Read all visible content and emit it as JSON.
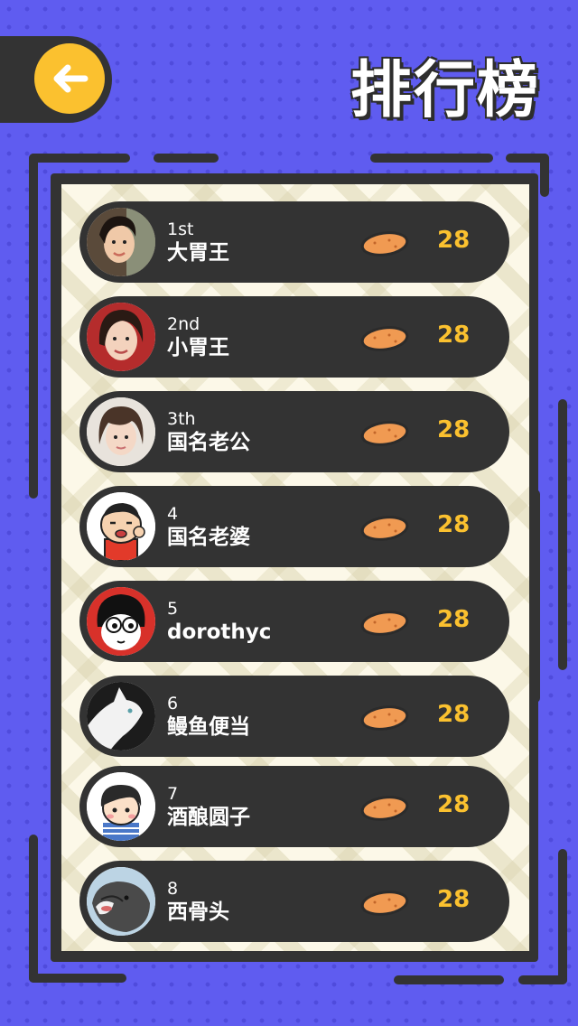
{
  "header": {
    "title": "排行榜",
    "back_icon": "arrow-left-icon",
    "accent": "#fbc12f"
  },
  "ranking": {
    "icon": "potato-icon",
    "items": [
      {
        "rank": "1st",
        "name": "大胃王",
        "score": "28"
      },
      {
        "rank": "2nd",
        "name": "小胃王",
        "score": "28"
      },
      {
        "rank": "3th",
        "name": "国名老公",
        "score": "28"
      },
      {
        "rank": "4",
        "name": "国名老婆",
        "score": "28"
      },
      {
        "rank": "5",
        "name": "dorothyc",
        "score": "28"
      },
      {
        "rank": "6",
        "name": "鳗鱼便当",
        "score": "28"
      },
      {
        "rank": "7",
        "name": "酒酿圆子",
        "score": "28"
      },
      {
        "rank": "8",
        "name": "西骨头",
        "score": "28"
      }
    ]
  },
  "colors": {
    "background": "#5f5cf0",
    "row": "#333333",
    "paper": "#fcf8e8",
    "score": "#fbc12f"
  }
}
